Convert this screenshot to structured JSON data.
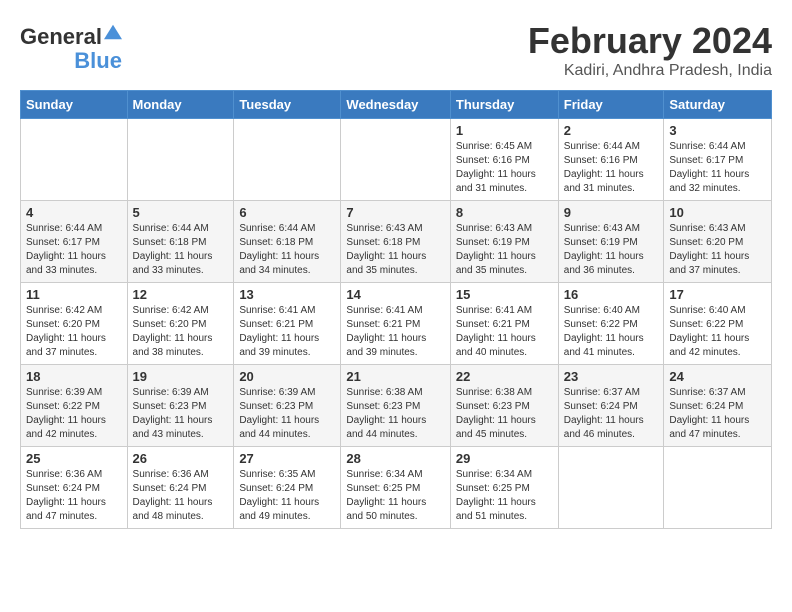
{
  "logo": {
    "line1": "General",
    "line2": "Blue"
  },
  "title": "February 2024",
  "subtitle": "Kadiri, Andhra Pradesh, India",
  "weekdays": [
    "Sunday",
    "Monday",
    "Tuesday",
    "Wednesday",
    "Thursday",
    "Friday",
    "Saturday"
  ],
  "weeks": [
    [
      {
        "day": "",
        "info": ""
      },
      {
        "day": "",
        "info": ""
      },
      {
        "day": "",
        "info": ""
      },
      {
        "day": "",
        "info": ""
      },
      {
        "day": "1",
        "info": "Sunrise: 6:45 AM\nSunset: 6:16 PM\nDaylight: 11 hours and 31 minutes."
      },
      {
        "day": "2",
        "info": "Sunrise: 6:44 AM\nSunset: 6:16 PM\nDaylight: 11 hours and 31 minutes."
      },
      {
        "day": "3",
        "info": "Sunrise: 6:44 AM\nSunset: 6:17 PM\nDaylight: 11 hours and 32 minutes."
      }
    ],
    [
      {
        "day": "4",
        "info": "Sunrise: 6:44 AM\nSunset: 6:17 PM\nDaylight: 11 hours and 33 minutes."
      },
      {
        "day": "5",
        "info": "Sunrise: 6:44 AM\nSunset: 6:18 PM\nDaylight: 11 hours and 33 minutes."
      },
      {
        "day": "6",
        "info": "Sunrise: 6:44 AM\nSunset: 6:18 PM\nDaylight: 11 hours and 34 minutes."
      },
      {
        "day": "7",
        "info": "Sunrise: 6:43 AM\nSunset: 6:18 PM\nDaylight: 11 hours and 35 minutes."
      },
      {
        "day": "8",
        "info": "Sunrise: 6:43 AM\nSunset: 6:19 PM\nDaylight: 11 hours and 35 minutes."
      },
      {
        "day": "9",
        "info": "Sunrise: 6:43 AM\nSunset: 6:19 PM\nDaylight: 11 hours and 36 minutes."
      },
      {
        "day": "10",
        "info": "Sunrise: 6:43 AM\nSunset: 6:20 PM\nDaylight: 11 hours and 37 minutes."
      }
    ],
    [
      {
        "day": "11",
        "info": "Sunrise: 6:42 AM\nSunset: 6:20 PM\nDaylight: 11 hours and 37 minutes."
      },
      {
        "day": "12",
        "info": "Sunrise: 6:42 AM\nSunset: 6:20 PM\nDaylight: 11 hours and 38 minutes."
      },
      {
        "day": "13",
        "info": "Sunrise: 6:41 AM\nSunset: 6:21 PM\nDaylight: 11 hours and 39 minutes."
      },
      {
        "day": "14",
        "info": "Sunrise: 6:41 AM\nSunset: 6:21 PM\nDaylight: 11 hours and 39 minutes."
      },
      {
        "day": "15",
        "info": "Sunrise: 6:41 AM\nSunset: 6:21 PM\nDaylight: 11 hours and 40 minutes."
      },
      {
        "day": "16",
        "info": "Sunrise: 6:40 AM\nSunset: 6:22 PM\nDaylight: 11 hours and 41 minutes."
      },
      {
        "day": "17",
        "info": "Sunrise: 6:40 AM\nSunset: 6:22 PM\nDaylight: 11 hours and 42 minutes."
      }
    ],
    [
      {
        "day": "18",
        "info": "Sunrise: 6:39 AM\nSunset: 6:22 PM\nDaylight: 11 hours and 42 minutes."
      },
      {
        "day": "19",
        "info": "Sunrise: 6:39 AM\nSunset: 6:23 PM\nDaylight: 11 hours and 43 minutes."
      },
      {
        "day": "20",
        "info": "Sunrise: 6:39 AM\nSunset: 6:23 PM\nDaylight: 11 hours and 44 minutes."
      },
      {
        "day": "21",
        "info": "Sunrise: 6:38 AM\nSunset: 6:23 PM\nDaylight: 11 hours and 44 minutes."
      },
      {
        "day": "22",
        "info": "Sunrise: 6:38 AM\nSunset: 6:23 PM\nDaylight: 11 hours and 45 minutes."
      },
      {
        "day": "23",
        "info": "Sunrise: 6:37 AM\nSunset: 6:24 PM\nDaylight: 11 hours and 46 minutes."
      },
      {
        "day": "24",
        "info": "Sunrise: 6:37 AM\nSunset: 6:24 PM\nDaylight: 11 hours and 47 minutes."
      }
    ],
    [
      {
        "day": "25",
        "info": "Sunrise: 6:36 AM\nSunset: 6:24 PM\nDaylight: 11 hours and 47 minutes."
      },
      {
        "day": "26",
        "info": "Sunrise: 6:36 AM\nSunset: 6:24 PM\nDaylight: 11 hours and 48 minutes."
      },
      {
        "day": "27",
        "info": "Sunrise: 6:35 AM\nSunset: 6:24 PM\nDaylight: 11 hours and 49 minutes."
      },
      {
        "day": "28",
        "info": "Sunrise: 6:34 AM\nSunset: 6:25 PM\nDaylight: 11 hours and 50 minutes."
      },
      {
        "day": "29",
        "info": "Sunrise: 6:34 AM\nSunset: 6:25 PM\nDaylight: 11 hours and 51 minutes."
      },
      {
        "day": "",
        "info": ""
      },
      {
        "day": "",
        "info": ""
      }
    ]
  ]
}
